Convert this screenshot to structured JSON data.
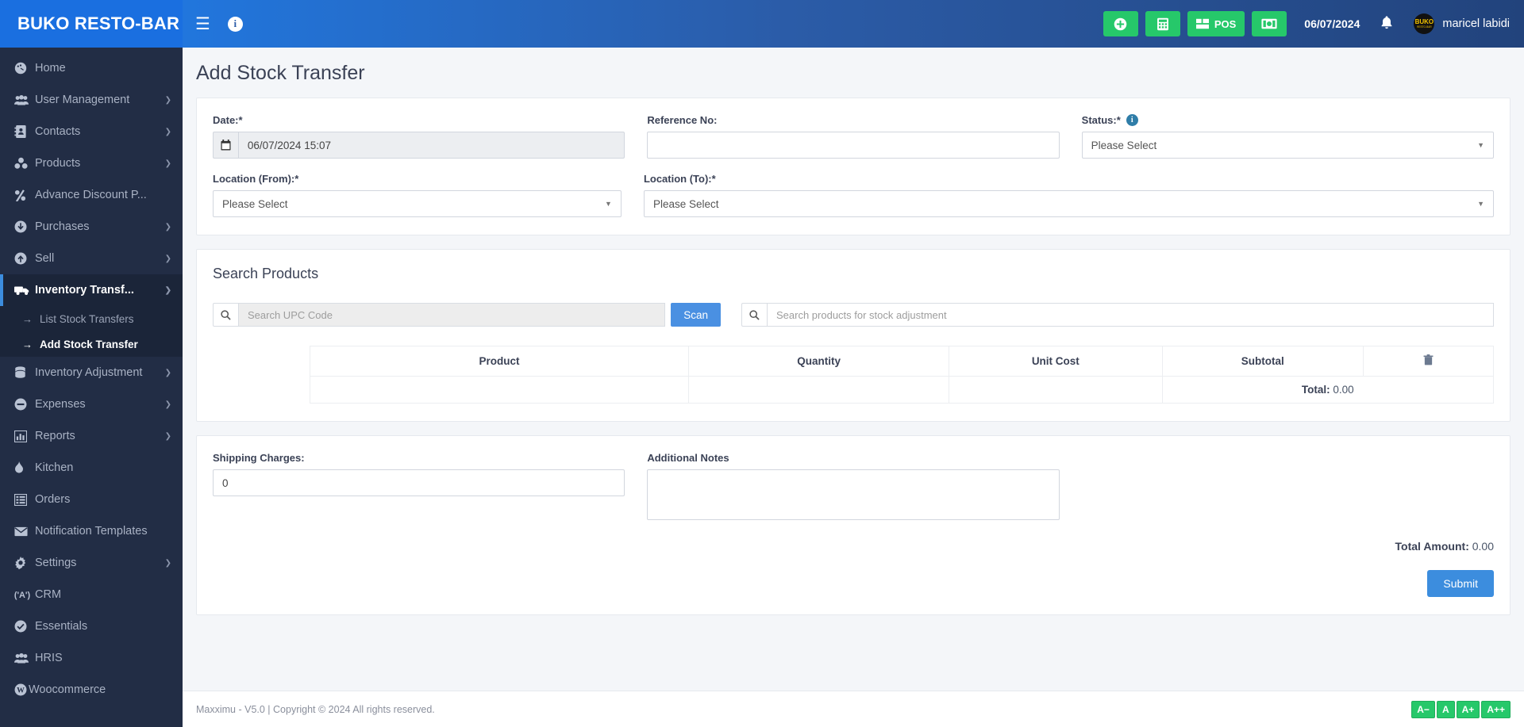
{
  "brand": {
    "name": "BUKO RESTO-BAR"
  },
  "header": {
    "menu_icon": "hamburger-icon",
    "info_icon": "info-icon",
    "buttons": [
      {
        "name": "add-button",
        "icon": "plus-circle-icon",
        "label": ""
      },
      {
        "name": "calculator-button",
        "icon": "calculator-icon",
        "label": ""
      },
      {
        "name": "pos-button",
        "icon": "grid-icon",
        "label": "POS"
      },
      {
        "name": "cash-register-button",
        "icon": "money-icon",
        "label": ""
      }
    ],
    "date": "06/07/2024",
    "notification_icon": "bell-icon",
    "avatar_text": "BUKO",
    "avatar_sub": "RESTO-BAR",
    "username": "maricel labidi"
  },
  "sidebar": {
    "items": [
      {
        "label": "Home",
        "icon": "dashboard-icon",
        "caret": false
      },
      {
        "label": "User Management",
        "icon": "users-icon",
        "caret": true
      },
      {
        "label": "Contacts",
        "icon": "contact-book-icon",
        "caret": true
      },
      {
        "label": "Products",
        "icon": "products-icon",
        "caret": true
      },
      {
        "label": "Advance Discount P...",
        "icon": "percent-icon",
        "caret": false
      },
      {
        "label": "Purchases",
        "icon": "arrow-down-circle-icon",
        "caret": true
      },
      {
        "label": "Sell",
        "icon": "arrow-up-circle-icon",
        "caret": true
      },
      {
        "label": "Inventory Transf...",
        "icon": "truck-icon",
        "caret": true,
        "active": true
      },
      {
        "label": "Inventory Adjustment",
        "icon": "database-icon",
        "caret": true
      },
      {
        "label": "Expenses",
        "icon": "minus-circle-icon",
        "caret": true
      },
      {
        "label": "Reports",
        "icon": "bar-chart-icon",
        "caret": true
      },
      {
        "label": "Kitchen",
        "icon": "flame-icon",
        "caret": false
      },
      {
        "label": "Orders",
        "icon": "list-icon",
        "caret": false
      },
      {
        "label": "Notification Templates",
        "icon": "envelope-icon",
        "caret": false
      },
      {
        "label": "Settings",
        "icon": "gear-icon",
        "caret": true
      },
      {
        "label": "CRM",
        "icon": "crm-icon",
        "caret": false
      },
      {
        "label": "Essentials",
        "icon": "check-circle-icon",
        "caret": false
      },
      {
        "label": "HRIS",
        "icon": "users-icon",
        "caret": false
      },
      {
        "label": "Woocommerce",
        "icon": "wordpress-icon",
        "caret": false
      }
    ],
    "submenu": [
      {
        "label": "List Stock Transfers",
        "current": false
      },
      {
        "label": "Add Stock Transfer",
        "current": true
      }
    ]
  },
  "page": {
    "title": "Add Stock Transfer"
  },
  "form": {
    "date_label": "Date:*",
    "date_value": "06/07/2024 15:07",
    "date_icon": "calendar-icon",
    "reference_label": "Reference No:",
    "reference_value": "",
    "status_label": "Status:*",
    "status_value": "Please Select",
    "location_from_label": "Location (From):*",
    "location_from_value": "Please Select",
    "location_to_label": "Location (To):*",
    "location_to_value": "Please Select"
  },
  "search_products": {
    "title": "Search Products",
    "upc_placeholder": "Search UPC Code",
    "upc_value": "",
    "scan_label": "Scan",
    "product_placeholder": "Search products for stock adjustment",
    "product_value": "",
    "search_icon": "search-icon"
  },
  "items_table": {
    "columns": [
      "Product",
      "Quantity",
      "Unit Cost",
      "Subtotal"
    ],
    "delete_icon": "trash-icon",
    "rows": [],
    "total_label": "Total:",
    "total_value": "0.00"
  },
  "bottom": {
    "shipping_label": "Shipping Charges:",
    "shipping_value": "0",
    "notes_label": "Additional Notes",
    "notes_value": "",
    "total_amount_label": "Total Amount:",
    "total_amount_value": "0.00",
    "submit_label": "Submit"
  },
  "footer": {
    "text": "Maxximu - V5.0 | Copyright © 2024 All rights reserved.",
    "font_buttons": [
      "A−",
      "A",
      "A+",
      "A++"
    ]
  },
  "colors": {
    "brand_blue": "#1a6fe0",
    "sidebar": "#222d45",
    "green": "#26c86a",
    "accent": "#3c8dde"
  }
}
